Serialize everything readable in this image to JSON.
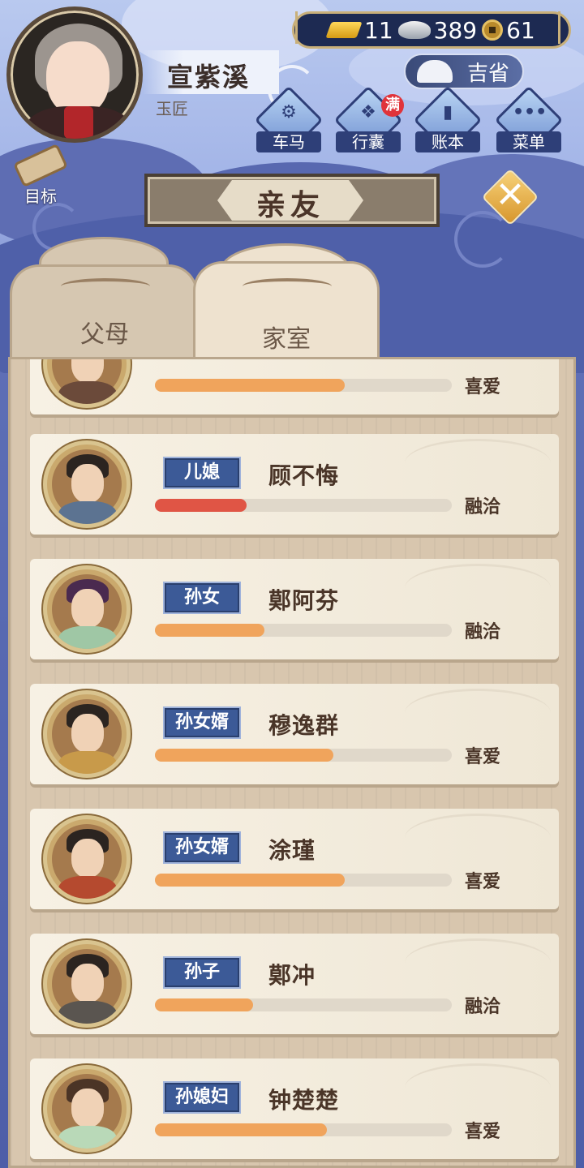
{
  "player": {
    "name": "宣紫溪",
    "title": "玉匠"
  },
  "currency": {
    "gold": "11",
    "silver": "389",
    "coins": "61"
  },
  "status": {
    "label": "吉省"
  },
  "menu": [
    {
      "label": "车马",
      "icon": "carriage-icon"
    },
    {
      "label": "行囊",
      "icon": "bag-icon",
      "badge": "满"
    },
    {
      "label": "账本",
      "icon": "ledger-icon"
    },
    {
      "label": "菜单",
      "icon": "more-icon"
    }
  ],
  "goal": {
    "label": "目标"
  },
  "page_title": "亲友",
  "tabs": [
    {
      "label": "父母",
      "active": false
    },
    {
      "label": "家室",
      "active": true
    }
  ],
  "colors": {
    "bar_orange": "#f0a45c",
    "bar_red": "#e05545",
    "badge_blue": "#3c5a97"
  },
  "relatives": [
    {
      "role": "",
      "name": "",
      "relation": "喜爱",
      "affinity": 0.64,
      "bar_color": "#f0a45c"
    },
    {
      "role": "儿媳",
      "name": "顾不悔",
      "relation": "融洽",
      "affinity": 0.31,
      "bar_color": "#e05545"
    },
    {
      "role": "孙女",
      "name": "鄚阿芬",
      "relation": "融洽",
      "affinity": 0.37,
      "bar_color": "#f0a45c"
    },
    {
      "role": "孙女婿",
      "name": "穆逸群",
      "relation": "喜爱",
      "affinity": 0.6,
      "bar_color": "#f0a45c"
    },
    {
      "role": "孙女婿",
      "name": "涂瑾",
      "relation": "喜爱",
      "affinity": 0.64,
      "bar_color": "#f0a45c"
    },
    {
      "role": "孙子",
      "name": "鄚冲",
      "relation": "融洽",
      "affinity": 0.33,
      "bar_color": "#f0a45c"
    },
    {
      "role": "孙媳妇",
      "name": "钟楚楚",
      "relation": "喜爱",
      "affinity": 0.58,
      "bar_color": "#f0a45c"
    }
  ]
}
